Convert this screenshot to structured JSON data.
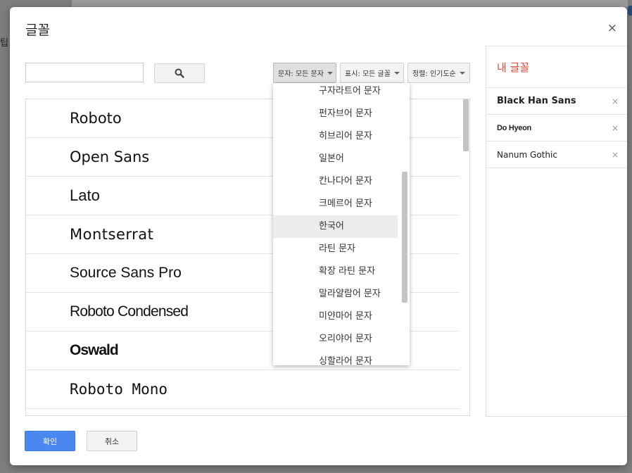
{
  "background": {
    "edge_text": "팁"
  },
  "dialog": {
    "title": "글꼴",
    "close_glyph": "×"
  },
  "search": {
    "value": "",
    "placeholder": "",
    "icon": "search-icon"
  },
  "filters": {
    "script": "문자: 모든 문자",
    "show": "표시: 모든 글꼴",
    "sort": "정렬: 인기도순"
  },
  "fonts": [
    {
      "name": "Roboto"
    },
    {
      "name": "Open Sans"
    },
    {
      "name": "Lato"
    },
    {
      "name": "Montserrat"
    },
    {
      "name": "Source Sans Pro"
    },
    {
      "name": "Roboto Condensed"
    },
    {
      "name": "Oswald"
    },
    {
      "name": "Roboto Mono"
    }
  ],
  "script_menu": {
    "items": [
      {
        "label": "구자라트어 문자"
      },
      {
        "label": "펀자브어 문자"
      },
      {
        "label": "히브리어 문자"
      },
      {
        "label": "일본어"
      },
      {
        "label": "칸나다어 문자"
      },
      {
        "label": "크메르어 문자"
      },
      {
        "label": "한국어",
        "highlighted": true
      },
      {
        "label": "라틴 문자"
      },
      {
        "label": "확장 라틴 문자"
      },
      {
        "label": "말라얄람어 문자"
      },
      {
        "label": "미얀마어 문자"
      },
      {
        "label": "오리야어 문자"
      },
      {
        "label": "싱할라어 문자"
      }
    ]
  },
  "my_fonts": {
    "title": "내 글꼴",
    "items": [
      {
        "name": "Black Han Sans"
      },
      {
        "name": "Do Hyeon"
      },
      {
        "name": "Nanum Gothic"
      }
    ],
    "remove_glyph": "×"
  },
  "buttons": {
    "ok": "확인",
    "cancel": "취소"
  },
  "colors": {
    "accent_blue": "#4a87ee",
    "my_fonts_title": "#dd4b39"
  }
}
